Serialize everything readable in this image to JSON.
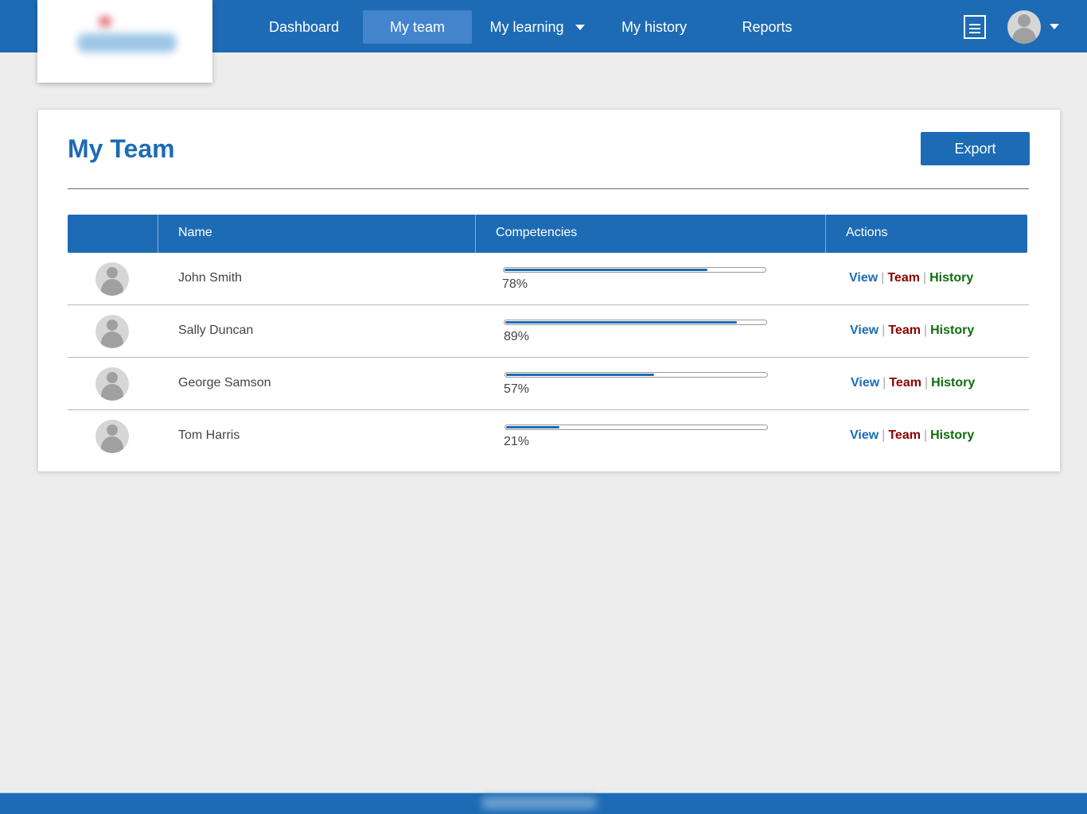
{
  "header": {
    "logo_alt": "Company logo",
    "nav": [
      {
        "label": "Dashboard",
        "active": false,
        "dropdown": false
      },
      {
        "label": "My team",
        "active": true,
        "dropdown": false
      },
      {
        "label": "My learning",
        "active": false,
        "dropdown": true
      },
      {
        "label": "My history",
        "active": false,
        "dropdown": false
      },
      {
        "label": "Reports",
        "active": false,
        "dropdown": false
      }
    ],
    "icons": {
      "menu": "list-icon",
      "user": "user-avatar-icon",
      "user_menu": "caret-down-icon"
    }
  },
  "main": {
    "title": "My Team",
    "export_label": "Export",
    "table": {
      "columns": [
        "",
        "Name",
        "Competencies",
        "Actions"
      ],
      "rows": [
        {
          "name": "John Smith",
          "competency": 78,
          "competency_label": "78%"
        },
        {
          "name": "Sally Duncan",
          "competency": 89,
          "competency_label": "89%"
        },
        {
          "name": "George Samson",
          "competency": 57,
          "competency_label": "57%"
        },
        {
          "name": "Tom Harris",
          "competency": 21,
          "competency_label": "21%"
        }
      ],
      "actions": {
        "view": "View",
        "team": "Team",
        "history": "History",
        "separator": "|"
      }
    }
  },
  "colors": {
    "primary": "#1d6bb5",
    "nav_active": "#4384cd",
    "view": "#1d6bb5",
    "team": "#8b0000",
    "history": "#0f6b0f",
    "background": "#ededed"
  }
}
